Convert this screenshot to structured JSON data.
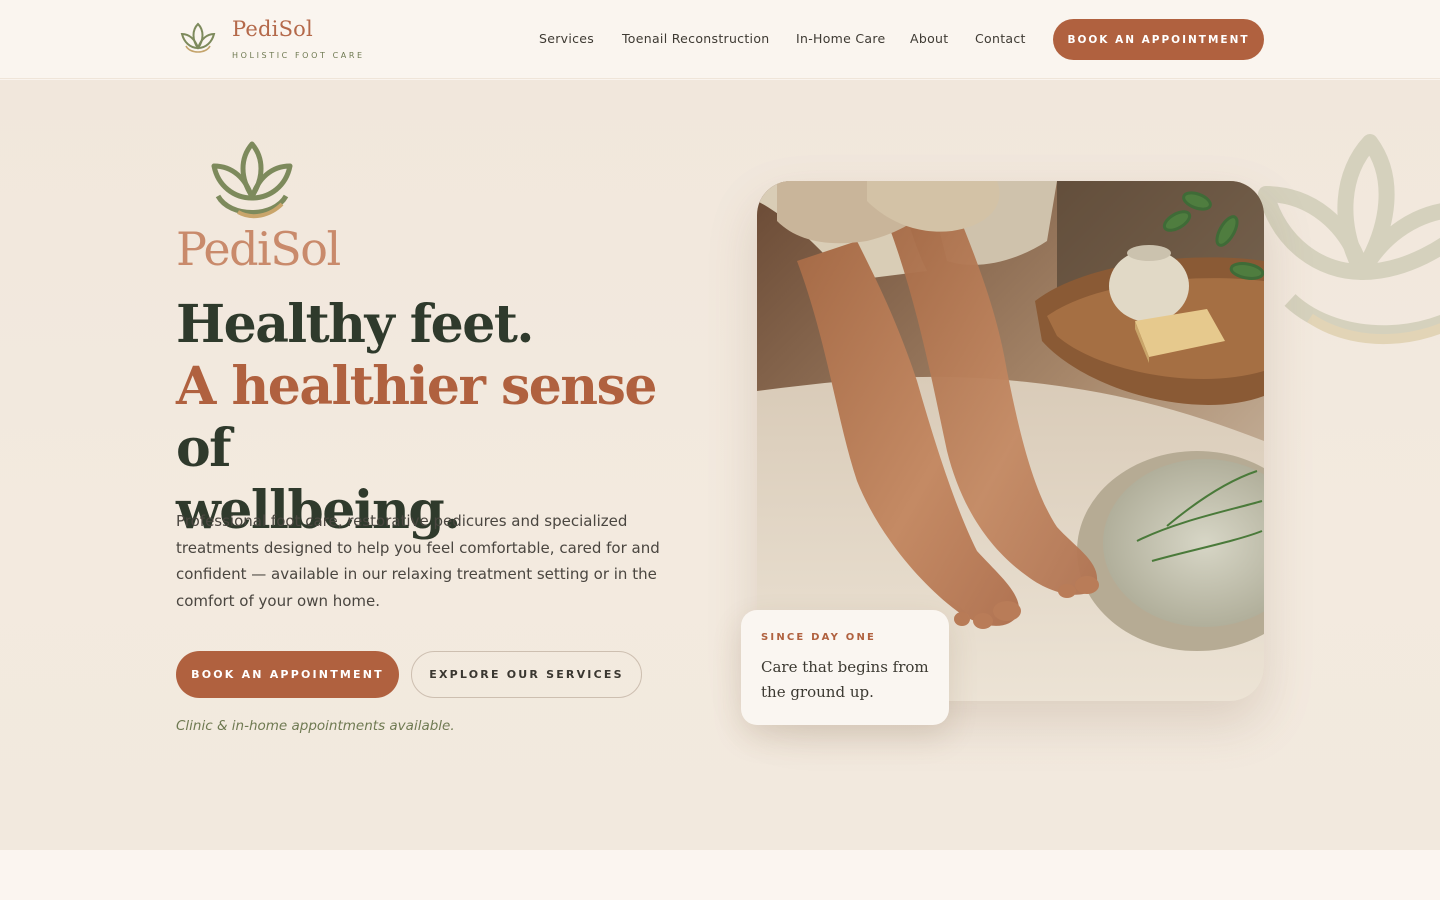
{
  "header": {
    "brand_name": "PediSol",
    "brand_tagline": "HOLISTIC FOOT CARE",
    "nav": [
      {
        "label": "Services"
      },
      {
        "label": "Toenail Reconstruction"
      },
      {
        "label": "In-Home Care"
      },
      {
        "label": "About"
      },
      {
        "label": "Contact"
      }
    ],
    "cta_label": "BOOK AN APPOINTMENT"
  },
  "hero": {
    "logo_text": "PediSol",
    "headline_line1": "Healthy feet.",
    "headline_accent": "A healthier sense",
    "headline_line2_rest": " of",
    "headline_line3": "wellbeing.",
    "description": "Professional foot care, restorative pedicures and specialized treatments designed to help you feel comfortable, cared for and confident — available in our relaxing treatment setting or in the comfort of your own home.",
    "primary_cta": "BOOK AN APPOINTMENT",
    "secondary_cta": "EXPLORE OUR SERVICES",
    "availability": "Clinic & in-home appointments available.",
    "card_eyebrow": "SINCE DAY ONE",
    "card_text": "Care that begins from the ground up."
  },
  "icons": {
    "brand": "lotus-leaf-icon",
    "hero_logo": "lotus-leaf-icon",
    "background": "lotus-outline-icon"
  },
  "colors": {
    "accent": "#b0613f",
    "olive": "#6f7a52",
    "heading": "#2f3a2c",
    "logo_peach": "#c98a6b",
    "background": "#f2e9de"
  }
}
